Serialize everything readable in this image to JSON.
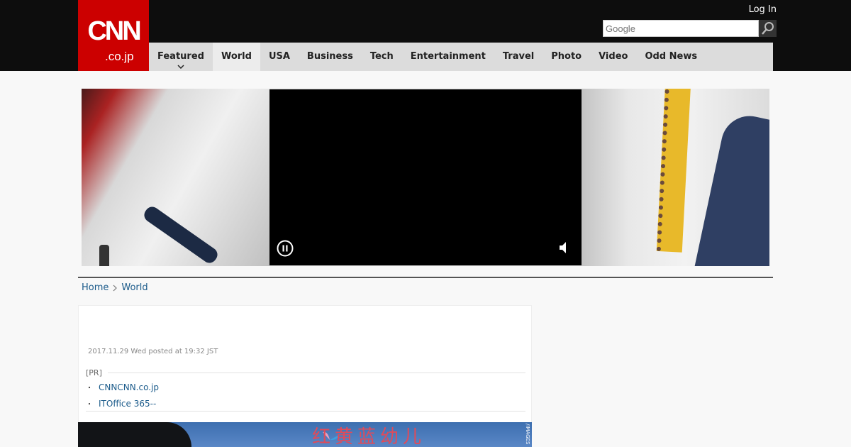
{
  "header": {
    "logo_main": "CNN",
    "logo_sub": ".co.jp",
    "login_label": "Log In",
    "search_placeholder": "Google"
  },
  "nav": {
    "items": [
      {
        "label": "Featured"
      },
      {
        "label": "World"
      },
      {
        "label": "USA"
      },
      {
        "label": "Business"
      },
      {
        "label": "Tech"
      },
      {
        "label": "Entertainment"
      },
      {
        "label": "Travel"
      },
      {
        "label": "Photo"
      },
      {
        "label": "Video"
      },
      {
        "label": "Odd News"
      }
    ],
    "active_index": 1
  },
  "video": {
    "pause_icon": "pause-circle-icon",
    "mute_icon": "speaker-icon"
  },
  "breadcrumb": {
    "home": "Home",
    "current": "World"
  },
  "article": {
    "posted": "2017.11.29 Wed posted at 19:32 JST",
    "pr_label": "[PR]",
    "pr_links": [
      {
        "text": "CNNCNN.co.jp"
      },
      {
        "text": "ITOffice 365--"
      }
    ]
  },
  "photo": {
    "sign_text": "红黄蓝幼儿",
    "credit": "/IMAGES"
  },
  "colors": {
    "brand_red": "#cc0000",
    "header_bg": "#0d0d0d",
    "nav_bg": "#dcdcdc",
    "link": "#1a5a8a"
  }
}
